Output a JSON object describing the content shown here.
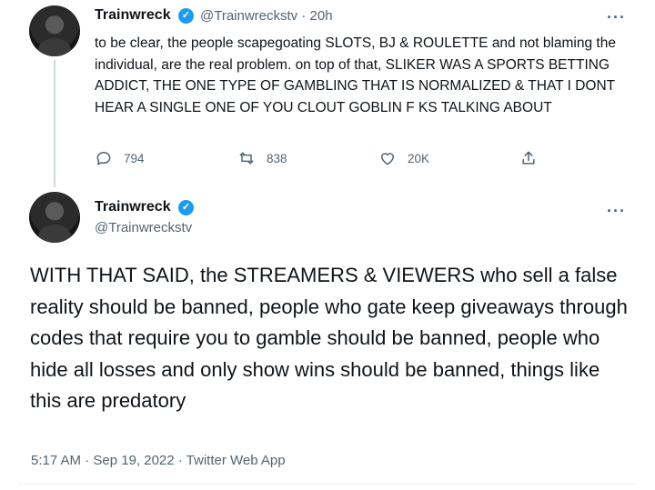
{
  "tweet1": {
    "author_name": "Trainwreck",
    "handle_time": "@Trainwreckstv · 20h",
    "text": "to be clear, the people scapegoating SLOTS, BJ & ROULETTE and not blaming the individual, are the real problem. on top of that, SLIKER WAS A SPORTS BETTING ADDICT, THE ONE TYPE OF GAMBLING THAT IS NORMALIZED & THAT I DONT HEAR A SINGLE ONE OF YOU CLOUT GOBLIN F    KS TALKING ABOUT",
    "replies": "794",
    "retweets": "838",
    "likes": "20K",
    "verified": true
  },
  "tweet2": {
    "author_name": "Trainwreck",
    "handle": "@Trainwreckstv",
    "text": "WITH THAT SAID, the STREAMERS & VIEWERS who sell a false reality should be banned, people who gate keep giveaways through codes that require you to gamble should be banned, people who hide all losses and only show wins should be banned, things like this are predatory",
    "timestamp_source": "5:17 AM · Sep 19, 2022 · Twitter Web App",
    "verified": true
  },
  "icons": {
    "more": "more-horizontal-icon",
    "reply": "reply-bubble-icon",
    "retweet": "retweet-arrows-icon",
    "like": "heart-icon",
    "share": "share-upload-icon",
    "verified": "verified-badge-icon"
  },
  "colors": {
    "text": "#0f1419",
    "secondary": "#536471",
    "verified": "#1d9bf0",
    "thread_line": "#cfd9de"
  }
}
